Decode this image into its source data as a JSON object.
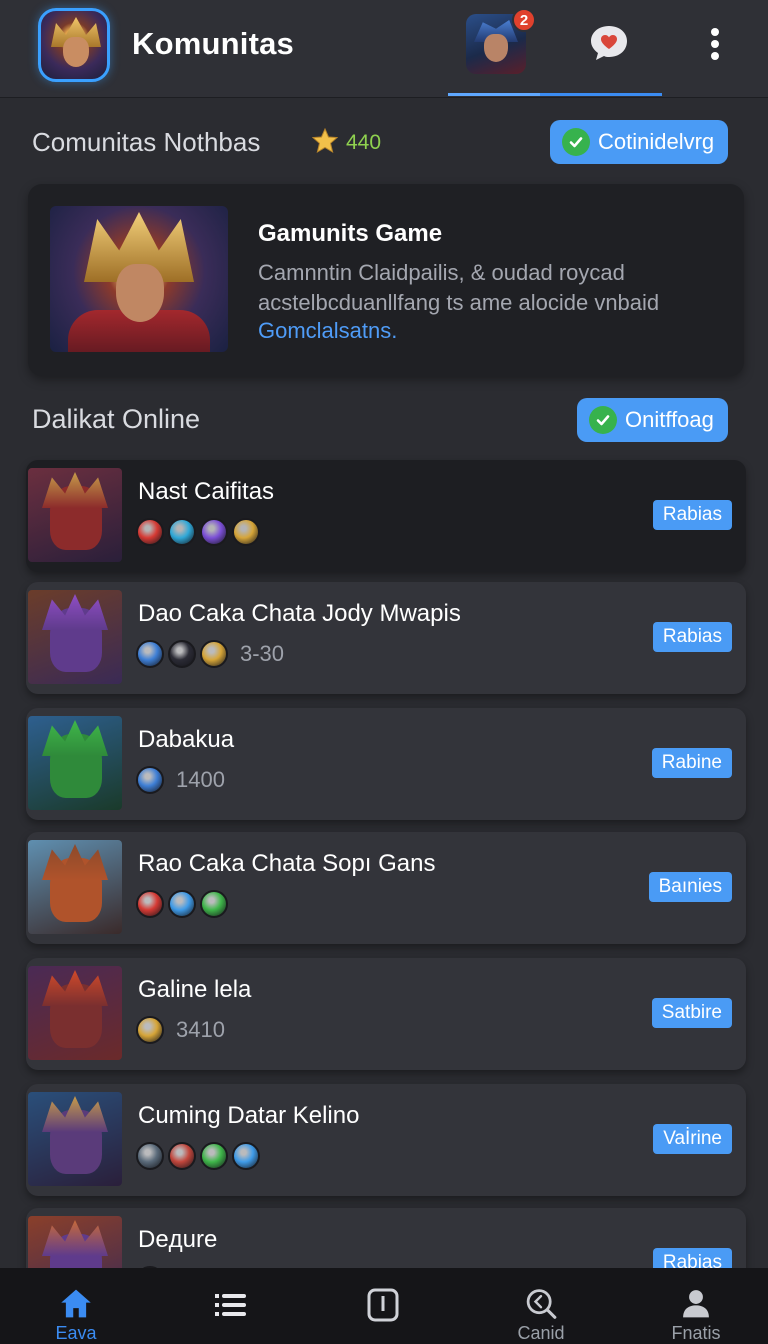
{
  "header": {
    "title": "Komunitas",
    "notification_count": "2"
  },
  "section_community": {
    "title": "Comunitas Nothbas",
    "star_count": "440",
    "button_label": "Cotinidelvrg"
  },
  "featured": {
    "title": "Gamunits Game",
    "description": "Camnntin Claidpailis, & oudad roycad acstelbcduanllfang ts ame alocide vnbaid",
    "link": "Gomclalsatns."
  },
  "section_online": {
    "title": "Dalikat Online",
    "button_label": "Onitffoag"
  },
  "list": [
    {
      "name": "Nast Caifitas",
      "stat": "",
      "tag": "Rabias",
      "gems": [
        "#d63a34",
        "#2fa8d8",
        "#7b4fd6",
        "#d6a538"
      ],
      "thumb": [
        "#6b2f3f",
        "#2a1f3a",
        "#c69b4a",
        "#8c2b2b"
      ]
    },
    {
      "name": "Dao Caka Chata Jody Mwapis",
      "stat": "3-30",
      "tag": "Rabias",
      "gems": [
        "#3e7fd6",
        "#2b2b35",
        "#d6a538"
      ],
      "thumb": [
        "#6b3d2a",
        "#3a2a55",
        "#8f4ec4",
        "#5f3b8c"
      ]
    },
    {
      "name": "Dabakua",
      "stat": "1400",
      "tag": "Rabine",
      "gems": [
        "#3e7fd6"
      ],
      "thumb": [
        "#2e5f8f",
        "#1a3a2a",
        "#3fb64a",
        "#2f8a3a"
      ]
    },
    {
      "name": "Rao Caka Chata Sopı Gans",
      "stat": "",
      "tag": "Baınies",
      "gems": [
        "#d63a34",
        "#3f9be8",
        "#3fb64a"
      ],
      "thumb": [
        "#5f8fb0",
        "#3a2a2a",
        "#8c4a2b",
        "#b0532b"
      ]
    },
    {
      "name": "Galine lela",
      "stat": "3410",
      "tag": "Satbire",
      "gems": [
        "#d6a538"
      ],
      "thumb": [
        "#4a2a55",
        "#6b2a2a",
        "#d04a2a",
        "#7a2f2f"
      ]
    },
    {
      "name": "Cuming Datar Kelino",
      "stat": "",
      "tag": "Vaİrine",
      "gems": [
        "#5a6a7a",
        "#c2463c",
        "#3fb64a",
        "#3f9be8"
      ],
      "thumb": [
        "#2a4f7a",
        "#2a1f3a",
        "#c69b4a",
        "#5a3b7a"
      ]
    },
    {
      "name": "Deдure",
      "stat": "",
      "tag": "Rabias",
      "gems": [
        "#d6a538"
      ],
      "thumb": [
        "#8a3f2a",
        "#3a2a55",
        "#c66a3a",
        "#5f3b8c"
      ]
    }
  ],
  "nav": [
    {
      "label": "Eava",
      "icon": "home-icon",
      "active": true
    },
    {
      "label": "",
      "icon": "list-icon",
      "active": false
    },
    {
      "label": "",
      "icon": "info-box-icon",
      "active": false
    },
    {
      "label": "Canid",
      "icon": "search-icon",
      "active": false
    },
    {
      "label": "Fnatis",
      "icon": "profile-icon",
      "active": false
    }
  ],
  "colors": {
    "accent": "#4a9bf5",
    "background": "#2b2c31",
    "success": "#37b24d",
    "badge": "#e0412d"
  }
}
